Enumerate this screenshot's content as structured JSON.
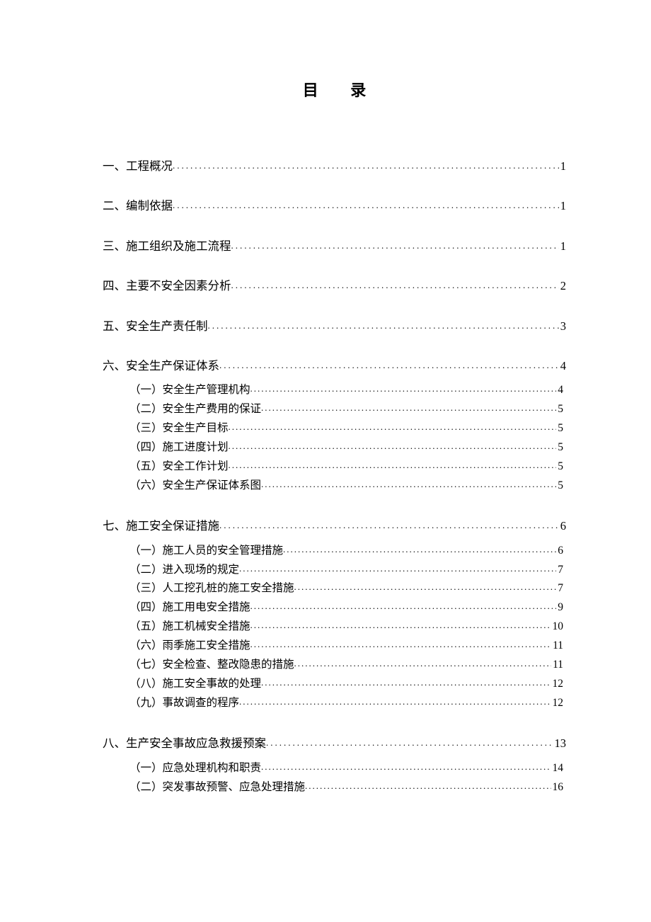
{
  "title": "目 录",
  "toc": [
    {
      "label": "一、工程概况",
      "page": "1",
      "children": []
    },
    {
      "label": "二、编制依据",
      "page": "1",
      "children": []
    },
    {
      "label": "三、施工组织及施工流程",
      "page": "1",
      "children": []
    },
    {
      "label": "四、主要不安全因素分析",
      "page": "2",
      "children": []
    },
    {
      "label": "五、安全生产责任制",
      "page": "3",
      "children": []
    },
    {
      "label": "六、安全生产保证体系",
      "page": "4",
      "children": [
        {
          "label": "（一）安全生产管理机构",
          "page": "4"
        },
        {
          "label": "（二）安全生产费用的保证 ",
          "page": "5"
        },
        {
          "label": "（三）安全生产目标 ",
          "page": "5"
        },
        {
          "label": "（四）施工进度计划 ",
          "page": "5"
        },
        {
          "label": "（五）安全工作计划 ",
          "page": "5"
        },
        {
          "label": "（六）安全生产保证体系图 ",
          "page": "5"
        }
      ]
    },
    {
      "label": "七、施工安全保证措施",
      "page": "6",
      "children": [
        {
          "label": "（一）施工人员的安全管理措施",
          "page": "6"
        },
        {
          "label": "（二）进入现场的规定 ",
          "page": "7"
        },
        {
          "label": "（三）人工挖孔桩的施工安全措施",
          "page": "7"
        },
        {
          "label": "（四）施工用电安全措施",
          "page": "9"
        },
        {
          "label": "（五）施工机械安全措施",
          "page": "10"
        },
        {
          "label": "（六）雨季施工安全措施",
          "page": "11"
        },
        {
          "label": "（七）安全检查、整改隐患的措施",
          "page": "11"
        },
        {
          "label": "（八）施工安全事故的处理 ",
          "page": "12"
        },
        {
          "label": "（九）事故调查的程序 ",
          "page": "12"
        }
      ]
    },
    {
      "label": "八、生产安全事故应急救援预案",
      "page": "13",
      "children": [
        {
          "label": "（一）应急处理机构和职责 ",
          "page": "14"
        },
        {
          "label": "（二）突发事故预警、应急处理措施 ",
          "page": "16"
        }
      ]
    }
  ]
}
